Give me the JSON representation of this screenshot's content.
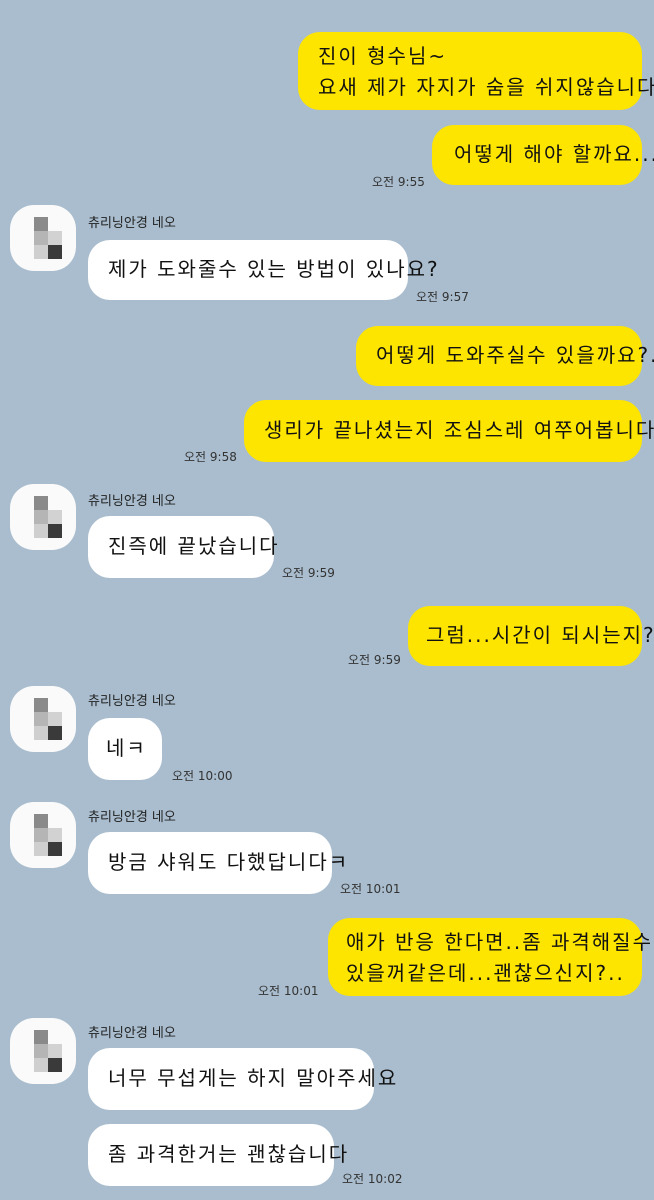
{
  "contact": {
    "name": "츄리닝안경 네오"
  },
  "messages": [
    {
      "from": "me",
      "lines": [
        "진이 형수님~",
        "요새 제가 자지가 숨을 쉬지않습니다..."
      ]
    },
    {
      "from": "me",
      "lines": [
        "어떻게 해야 할까요..."
      ],
      "time": "오전 9:55"
    },
    {
      "from": "them",
      "lines": [
        "제가 도와줄수 있는 방법이 있나요?"
      ],
      "time": "오전 9:57"
    },
    {
      "from": "me",
      "lines": [
        "어떻게 도와주실수 있을까요?.."
      ]
    },
    {
      "from": "me",
      "lines": [
        "생리가 끝나셨는지 조심스레 여쭈어봅니다..?"
      ],
      "time": "오전 9:58"
    },
    {
      "from": "them",
      "lines": [
        "진즉에 끝났습니다"
      ],
      "time": "오전 9:59"
    },
    {
      "from": "me",
      "lines": [
        "그럼...시간이 되시는지?"
      ],
      "time": "오전 9:59"
    },
    {
      "from": "them",
      "lines": [
        "네ㅋ"
      ],
      "time": "오전 10:00"
    },
    {
      "from": "them",
      "lines": [
        "방금 샤워도 다했답니다ㅋ"
      ],
      "time": "오전 10:01"
    },
    {
      "from": "me",
      "lines": [
        "애가 반응 한다면..좀 과격해질수도",
        "있을꺼같은데...괜찮으신지?.."
      ],
      "time": "오전 10:01"
    },
    {
      "from": "them",
      "lines": [
        "너무 무섭게는 하지 말아주세요"
      ]
    },
    {
      "from": "them",
      "lines": [
        "좀 과격한거는 괜찮습니다"
      ],
      "time": "오전 10:02"
    }
  ],
  "colors": {
    "background": "#a9bdce",
    "my_bubble": "#fee500",
    "their_bubble": "#ffffff"
  }
}
